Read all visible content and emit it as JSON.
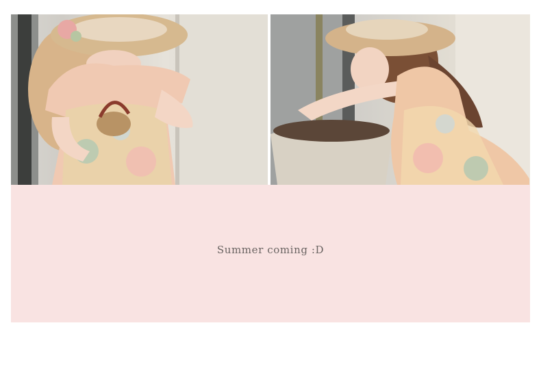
{
  "photos": [
    {
      "name": "left-photo",
      "subject": "girl-with-basket-photo"
    },
    {
      "name": "right-photo",
      "subject": "girl-with-plant-pot-photo"
    }
  ],
  "caption": {
    "text": "Summer coming :D"
  },
  "colors": {
    "panel_background": "#f9e3e2",
    "caption_text": "#6a6462",
    "page_background": "#ffffff"
  }
}
